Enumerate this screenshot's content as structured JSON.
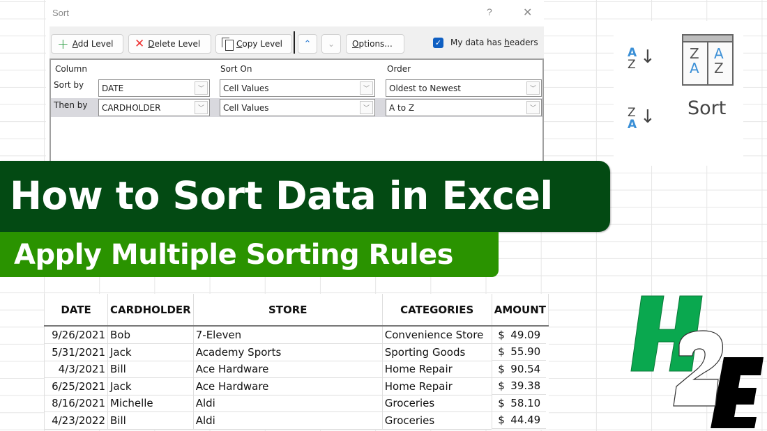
{
  "dialog": {
    "title": "Sort",
    "help_label": "?",
    "close_label": "✕",
    "toolbar": {
      "add_level": {
        "accel": "A",
        "rest": "dd Level"
      },
      "delete_level": {
        "accel": "D",
        "rest": "elete Level"
      },
      "copy_level": {
        "accel": "C",
        "rest": "opy Level"
      },
      "move_up_icon": "⌃",
      "move_down_icon": "⌄",
      "options": {
        "accel": "O",
        "rest": "ptions..."
      },
      "headers_checkbox": {
        "checked": true,
        "check_glyph": "✓",
        "pre": "My data has ",
        "accel": "h",
        "rest": "eaders"
      }
    },
    "columns": {
      "column": "Column",
      "sort_on": "Sort On",
      "order": "Order"
    },
    "levels": [
      {
        "label": "Sort by",
        "column": "DATE",
        "sort_on": "Cell Values",
        "order": "Oldest to Newest"
      },
      {
        "label": "Then by",
        "column": "CARDHOLDER",
        "sort_on": "Cell Values",
        "order": "A to Z"
      }
    ],
    "dropdown_glyph": "﹀"
  },
  "ribbon": {
    "sort_az": {
      "top": "A",
      "bottom": "Z",
      "arrow": "↓"
    },
    "sort_za": {
      "top": "Z",
      "bottom": "A",
      "arrow": "↓"
    },
    "sort_icon": {
      "left_top": "Z",
      "left_bottom": "A",
      "right_top": "A",
      "right_bottom": "Z"
    },
    "sort_label": "Sort"
  },
  "banner": {
    "title": "How to Sort Data in Excel",
    "subtitle": "Apply Multiple Sorting Rules",
    "colors": {
      "title_bg": "#034a13",
      "subtitle_bg": "#2a9300"
    }
  },
  "table": {
    "headers": [
      "DATE",
      "CARDHOLDER",
      "STORE",
      "CATEGORIES",
      "AMOUNT"
    ],
    "rows": [
      {
        "date": "9/26/2021",
        "cardholder": "Bob",
        "store": "7-Eleven",
        "category": "Convenience Store",
        "currency": "$",
        "amount": "49.09"
      },
      {
        "date": "5/31/2021",
        "cardholder": "Jack",
        "store": "Academy Sports",
        "category": "Sporting Goods",
        "currency": "$",
        "amount": "55.90"
      },
      {
        "date": "4/3/2021",
        "cardholder": "Bill",
        "store": "Ace Hardware",
        "category": "Home Repair",
        "currency": "$",
        "amount": "90.54"
      },
      {
        "date": "6/25/2021",
        "cardholder": "Jack",
        "store": "Ace Hardware",
        "category": "Home Repair",
        "currency": "$",
        "amount": "39.38"
      },
      {
        "date": "8/16/2021",
        "cardholder": "Michelle",
        "store": "Aldi",
        "category": "Groceries",
        "currency": "$",
        "amount": "58.10"
      },
      {
        "date": "4/23/2022",
        "cardholder": "Bill",
        "store": "Aldi",
        "category": "Groceries",
        "currency": "$",
        "amount": "44.49"
      }
    ]
  },
  "logo": {
    "letters": [
      "H",
      "2",
      "E"
    ],
    "colors": {
      "h": "#0aa84f",
      "two": "#ffffff",
      "e": "#000000"
    }
  }
}
